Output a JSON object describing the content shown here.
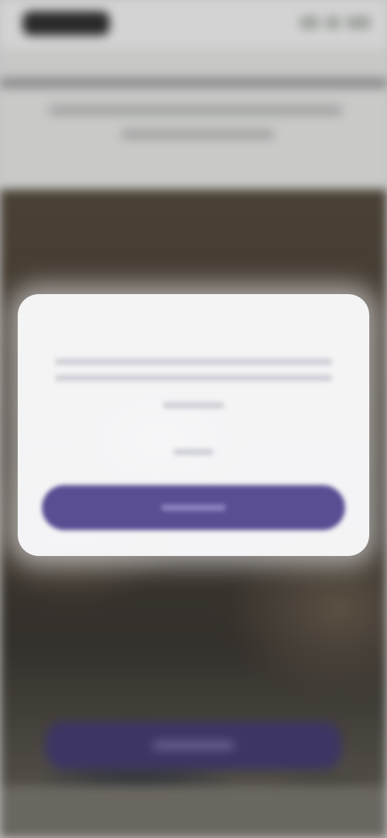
{
  "screen": {
    "background_colors": {
      "status_bar": "#d2d3d2",
      "photo_dark": "#3f382f",
      "modal_bg": "#fafafc",
      "accent": "#5a4e93"
    }
  },
  "status_bar": {
    "time_placeholder": "",
    "icons": [
      "signal-icon",
      "wifi-icon",
      "battery-icon"
    ]
  },
  "banner": {
    "text": ""
  },
  "modal": {
    "title": "",
    "body_lines": 3,
    "secondary_action": "",
    "primary_action": ""
  },
  "background_cta": {
    "label": ""
  }
}
